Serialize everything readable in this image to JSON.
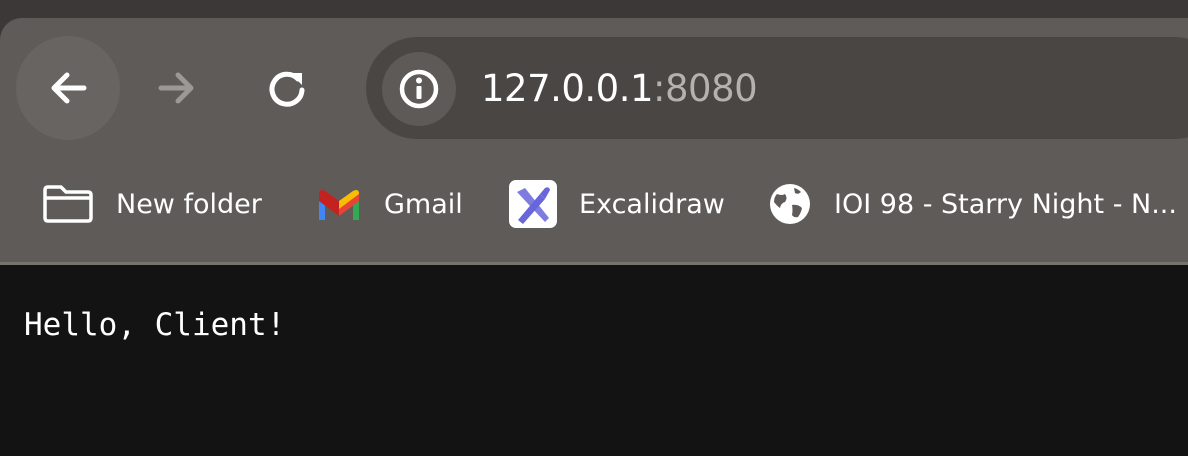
{
  "browser": {
    "nav": {
      "back_icon": "arrow-left-icon",
      "forward_icon": "arrow-right-icon",
      "reload_icon": "reload-icon"
    },
    "omnibox": {
      "site_info_icon": "info-icon",
      "host": "127.0.0.1",
      "port": ":8080"
    },
    "bookmarks": [
      {
        "label": "New folder",
        "icon": "folder-icon"
      },
      {
        "label": "Gmail",
        "icon": "gmail-icon"
      },
      {
        "label": "Excalidraw",
        "icon": "excalidraw-icon"
      },
      {
        "label": "IOI 98 - Starry Night - N...",
        "icon": "globe-icon"
      }
    ],
    "colors": {
      "frame": "#3c3838",
      "toolbar": "#5f5b58",
      "omnibox": "#4a4644",
      "page_background": "#131313",
      "excalidraw_brand": "#6965db"
    }
  },
  "page": {
    "text": "Hello, Client!"
  }
}
